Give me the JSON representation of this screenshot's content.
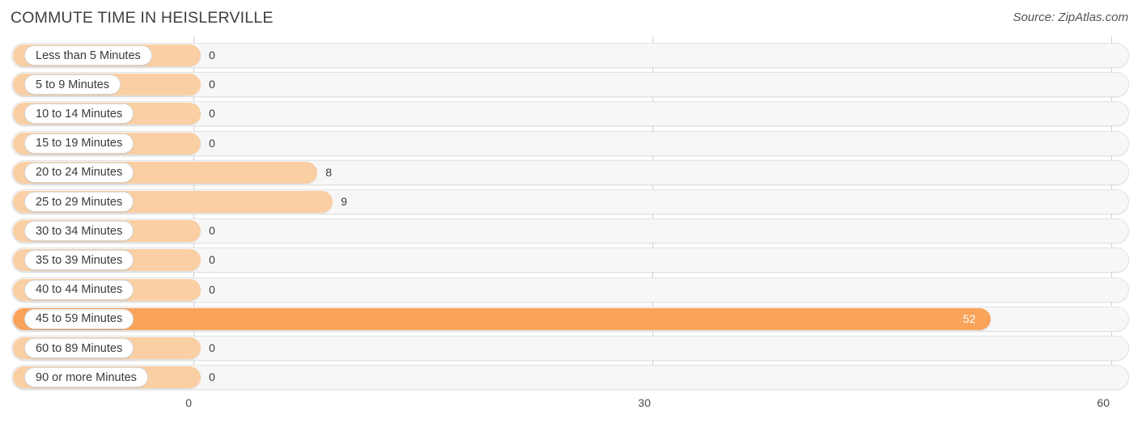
{
  "header": {
    "title": "COMMUTE TIME IN HEISLERVILLE",
    "source": "Source: ZipAtlas.com"
  },
  "colors": {
    "bar": "#facfa4",
    "bar_highlight": "#f9a35b",
    "track": "#f7f7f7",
    "track_border": "#e3e3e3",
    "gridline": "#cfcfcf",
    "text": "#3a3a3a"
  },
  "chart_data": {
    "type": "bar",
    "orientation": "horizontal",
    "title": "COMMUTE TIME IN HEISLERVILLE",
    "xlabel": "",
    "ylabel": "",
    "xlim": [
      0,
      60
    ],
    "grid": true,
    "ticks": [
      {
        "label": "0",
        "value": 0
      },
      {
        "label": "30",
        "value": 30
      },
      {
        "label": "60",
        "value": 60
      }
    ],
    "categories": [
      "Less than 5 Minutes",
      "5 to 9 Minutes",
      "10 to 14 Minutes",
      "15 to 19 Minutes",
      "20 to 24 Minutes",
      "25 to 29 Minutes",
      "30 to 34 Minutes",
      "35 to 39 Minutes",
      "40 to 44 Minutes",
      "45 to 59 Minutes",
      "60 to 89 Minutes",
      "90 or more Minutes"
    ],
    "values": [
      0,
      0,
      0,
      0,
      8,
      9,
      0,
      0,
      0,
      52,
      0,
      0
    ],
    "value_labels": [
      "0",
      "0",
      "0",
      "0",
      "8",
      "9",
      "0",
      "0",
      "0",
      "52",
      "0",
      "0"
    ],
    "highlight_index": 9
  }
}
